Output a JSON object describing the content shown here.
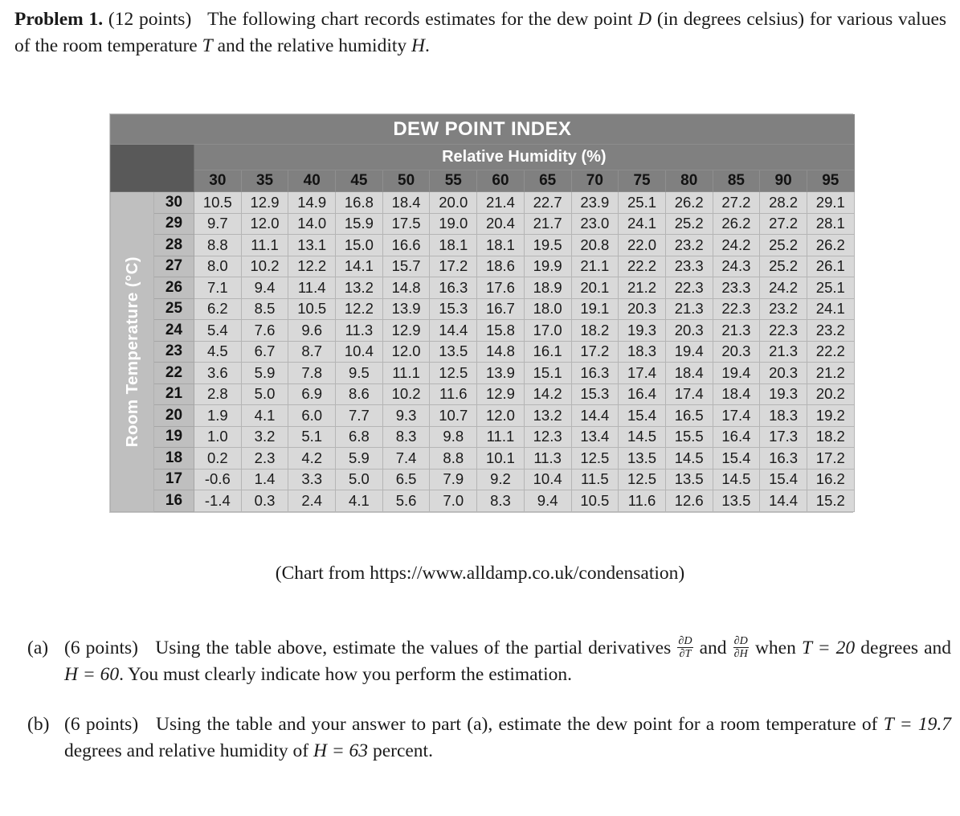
{
  "problem": {
    "label": "Problem 1.",
    "points": "(12 points)",
    "stem_part1": "The following chart records estimates for the dew point",
    "var_D": "D",
    "stem_part2": "(in degrees celsius) for various values of the room temperature",
    "var_T": "T",
    "stem_part3": "and the relative humidity",
    "var_H": "H",
    "stem_end": "."
  },
  "table": {
    "title": "DEW POINT INDEX",
    "column_group_label": "Relative Humidity (%)",
    "row_group_label": "Room Temperature (°C)",
    "colors": {
      "title_band": "#808080",
      "corner_dark": "#595959",
      "header_gray": "#808080",
      "row_header_gray": "#bfbfbf",
      "data_cell_gray": "#d9d9d9",
      "grid_line": "#a6a6a6",
      "title_text": "#ffffff"
    }
  },
  "chart_data": {
    "type": "table",
    "title": "DEW POINT INDEX",
    "xlabel": "Relative Humidity (%)",
    "ylabel": "Room Temperature (°C)",
    "grid": true,
    "legend": "none",
    "humidity_columns": [
      30,
      35,
      40,
      45,
      50,
      55,
      60,
      65,
      70,
      75,
      80,
      85,
      90,
      95
    ],
    "temperature_rows": [
      30,
      29,
      28,
      27,
      26,
      25,
      24,
      23,
      22,
      21,
      20,
      19,
      18,
      17,
      16
    ],
    "rows": [
      {
        "T": "30",
        "values": [
          "10.5",
          "12.9",
          "14.9",
          "16.8",
          "18.4",
          "20.0",
          "21.4",
          "22.7",
          "23.9",
          "25.1",
          "26.2",
          "27.2",
          "28.2",
          "29.1"
        ]
      },
      {
        "T": "29",
        "values": [
          "9.7",
          "12.0",
          "14.0",
          "15.9",
          "17.5",
          "19.0",
          "20.4",
          "21.7",
          "23.0",
          "24.1",
          "25.2",
          "26.2",
          "27.2",
          "28.1"
        ]
      },
      {
        "T": "28",
        "values": [
          "8.8",
          "11.1",
          "13.1",
          "15.0",
          "16.6",
          "18.1",
          "18.1",
          "19.5",
          "20.8",
          "22.0",
          "23.2",
          "24.2",
          "25.2",
          "26.2"
        ]
      },
      {
        "T": "27",
        "values": [
          "8.0",
          "10.2",
          "12.2",
          "14.1",
          "15.7",
          "17.2",
          "18.6",
          "19.9",
          "21.1",
          "22.2",
          "23.3",
          "24.3",
          "25.2",
          "26.1"
        ]
      },
      {
        "T": "26",
        "values": [
          "7.1",
          "9.4",
          "11.4",
          "13.2",
          "14.8",
          "16.3",
          "17.6",
          "18.9",
          "20.1",
          "21.2",
          "22.3",
          "23.3",
          "24.2",
          "25.1"
        ]
      },
      {
        "T": "25",
        "values": [
          "6.2",
          "8.5",
          "10.5",
          "12.2",
          "13.9",
          "15.3",
          "16.7",
          "18.0",
          "19.1",
          "20.3",
          "21.3",
          "22.3",
          "23.2",
          "24.1"
        ]
      },
      {
        "T": "24",
        "values": [
          "5.4",
          "7.6",
          "9.6",
          "11.3",
          "12.9",
          "14.4",
          "15.8",
          "17.0",
          "18.2",
          "19.3",
          "20.3",
          "21.3",
          "22.3",
          "23.2"
        ]
      },
      {
        "T": "23",
        "values": [
          "4.5",
          "6.7",
          "8.7",
          "10.4",
          "12.0",
          "13.5",
          "14.8",
          "16.1",
          "17.2",
          "18.3",
          "19.4",
          "20.3",
          "21.3",
          "22.2"
        ]
      },
      {
        "T": "22",
        "values": [
          "3.6",
          "5.9",
          "7.8",
          "9.5",
          "11.1",
          "12.5",
          "13.9",
          "15.1",
          "16.3",
          "17.4",
          "18.4",
          "19.4",
          "20.3",
          "21.2"
        ]
      },
      {
        "T": "21",
        "values": [
          "2.8",
          "5.0",
          "6.9",
          "8.6",
          "10.2",
          "11.6",
          "12.9",
          "14.2",
          "15.3",
          "16.4",
          "17.4",
          "18.4",
          "19.3",
          "20.2"
        ]
      },
      {
        "T": "20",
        "values": [
          "1.9",
          "4.1",
          "6.0",
          "7.7",
          "9.3",
          "10.7",
          "12.0",
          "13.2",
          "14.4",
          "15.4",
          "16.5",
          "17.4",
          "18.3",
          "19.2"
        ]
      },
      {
        "T": "19",
        "values": [
          "1.0",
          "3.2",
          "5.1",
          "6.8",
          "8.3",
          "9.8",
          "11.1",
          "12.3",
          "13.4",
          "14.5",
          "15.5",
          "16.4",
          "17.3",
          "18.2"
        ]
      },
      {
        "T": "18",
        "values": [
          "0.2",
          "2.3",
          "4.2",
          "5.9",
          "7.4",
          "8.8",
          "10.1",
          "11.3",
          "12.5",
          "13.5",
          "14.5",
          "15.4",
          "16.3",
          "17.2"
        ]
      },
      {
        "T": "17",
        "values": [
          "-0.6",
          "1.4",
          "3.3",
          "5.0",
          "6.5",
          "7.9",
          "9.2",
          "10.4",
          "11.5",
          "12.5",
          "13.5",
          "14.5",
          "15.4",
          "16.2"
        ]
      },
      {
        "T": "16",
        "values": [
          "-1.4",
          "0.3",
          "2.4",
          "4.1",
          "5.6",
          "7.0",
          "8.3",
          "9.4",
          "10.5",
          "11.6",
          "12.6",
          "13.5",
          "14.4",
          "15.2"
        ]
      }
    ]
  },
  "caption": "(Chart from https://www.alldamp.co.uk/condensation)",
  "parts": {
    "a": {
      "label": "(a)",
      "points": "(6 points)",
      "text1": "Using the table above, estimate the values of the partial derivatives",
      "frac1_num": "∂D",
      "frac1_den": "∂T",
      "text2": "and",
      "frac2_num": "∂D",
      "frac2_den": "∂H",
      "text3": "when",
      "cond_T": "T = 20",
      "text4": "degrees and",
      "cond_H": "H = 60",
      "text5": ". You must clearly indicate how you perform the estimation."
    },
    "b": {
      "label": "(b)",
      "points": "(6 points)",
      "text1": "Using the table and your answer to part (a), estimate the dew point for a room temperature of",
      "cond_T": "T = 19.7",
      "text2": "degrees and relative humidity of",
      "cond_H": "H = 63",
      "text3": "percent."
    }
  }
}
